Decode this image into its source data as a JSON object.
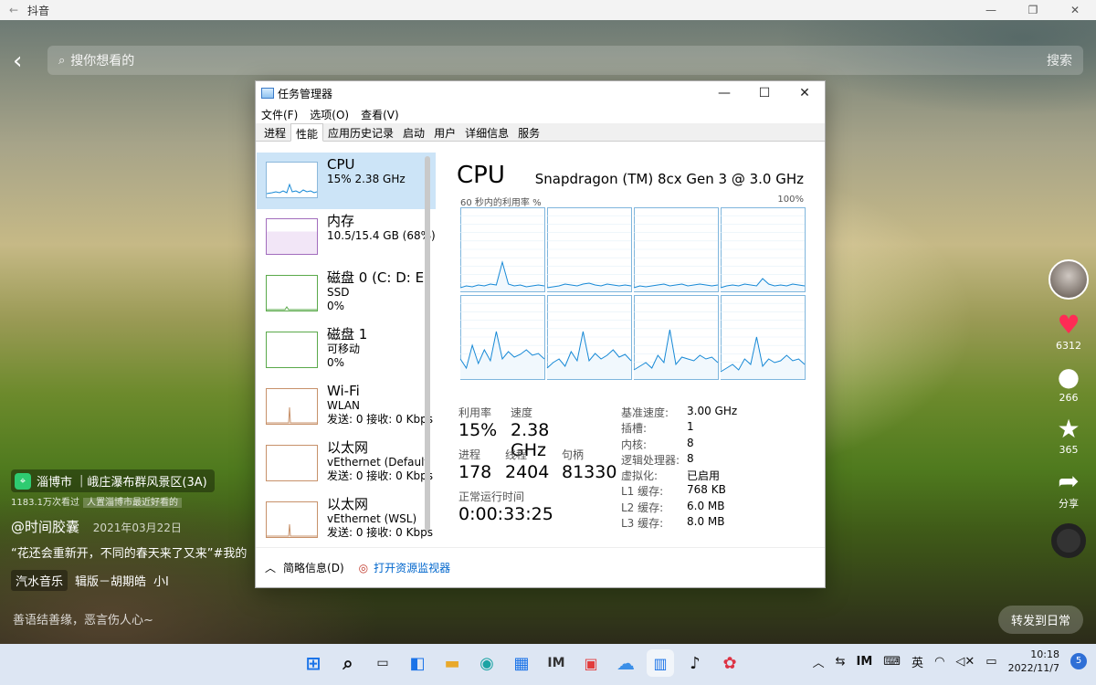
{
  "douyin": {
    "window_title": "抖音",
    "search_placeholder": "搜你想看的",
    "search_button": "搜索",
    "location": {
      "city": "淄博市",
      "place": "峨庄瀑布群风景区(3A)",
      "visits": "1183.1万次看过",
      "ad": "人置淄博市最近好看的"
    },
    "author": "@时间胶囊",
    "date": "2021年03月22日",
    "description": "“花还会重新开，不同的春天来了又来”#我的",
    "music_tag": "汽水音乐",
    "music_name": "辑版－胡期皓",
    "music_artist": "小I",
    "comment_hint": "善语结善缘，恶言伤人心~",
    "forward_button": "转发到日常",
    "likes": "6312",
    "comments": "266",
    "favorites": "365",
    "share": "分享"
  },
  "taskmgr": {
    "title": "任务管理器",
    "menu": [
      "文件(F)",
      "选项(O)",
      "查看(V)"
    ],
    "tabs": [
      "进程",
      "性能",
      "应用历史记录",
      "启动",
      "用户",
      "详细信息",
      "服务"
    ],
    "active_tab": "性能",
    "sidebar": [
      {
        "title": "CPU",
        "lines": [
          "15%  2.38 GHz"
        ],
        "kind": "cpu"
      },
      {
        "title": "内存",
        "lines": [
          "10.5/15.4 GB (68%)"
        ],
        "kind": "mem"
      },
      {
        "title": "磁盘 0 (C: D: E:",
        "lines": [
          "SSD",
          "0%"
        ],
        "kind": "disk"
      },
      {
        "title": "磁盘 1",
        "lines": [
          "可移动",
          "0%"
        ],
        "kind": "disk"
      },
      {
        "title": "Wi-Fi",
        "lines": [
          "WLAN",
          "发送: 0 接收: 0 Kbps"
        ],
        "kind": "net"
      },
      {
        "title": "以太网",
        "lines": [
          "vEthernet (Default",
          "发送: 0 接收: 0 Kbps"
        ],
        "kind": "net"
      },
      {
        "title": "以太网",
        "lines": [
          "vEthernet (WSL)",
          "发送: 0 接收: 0 Kbps"
        ],
        "kind": "net"
      }
    ],
    "cpu_heading": "CPU",
    "cpu_name": "Snapdragon (TM) 8cx Gen 3 @ 3.0 GHz",
    "util_label": "60 秒内的利用率 %",
    "util_max": "100%",
    "stats": {
      "util_label": "利用率",
      "util": "15%",
      "speed_label": "速度",
      "speed": "2.38 GHz",
      "proc_label": "进程",
      "proc": "178",
      "thread_label": "线程",
      "thread": "2404",
      "handle_label": "句柄",
      "handle": "81330",
      "uptime_label": "正常运行时间",
      "uptime": "0:00:33:25"
    },
    "specs": [
      [
        "基准速度:",
        "3.00 GHz"
      ],
      [
        "插槽:",
        "1"
      ],
      [
        "内核:",
        "8"
      ],
      [
        "逻辑处理器:",
        "8"
      ],
      [
        "虚拟化:",
        "已启用"
      ],
      [
        "L1 缓存:",
        "768 KB"
      ],
      [
        "L2 缓存:",
        "6.0 MB"
      ],
      [
        "L3 缓存:",
        "8.0 MB"
      ]
    ],
    "fewer_details": "简略信息(D)",
    "resource_monitor": "打开资源监视器"
  },
  "taskbar": {
    "ime": "英",
    "time": "10:18",
    "date": "2022/11/7",
    "badge": "5"
  }
}
